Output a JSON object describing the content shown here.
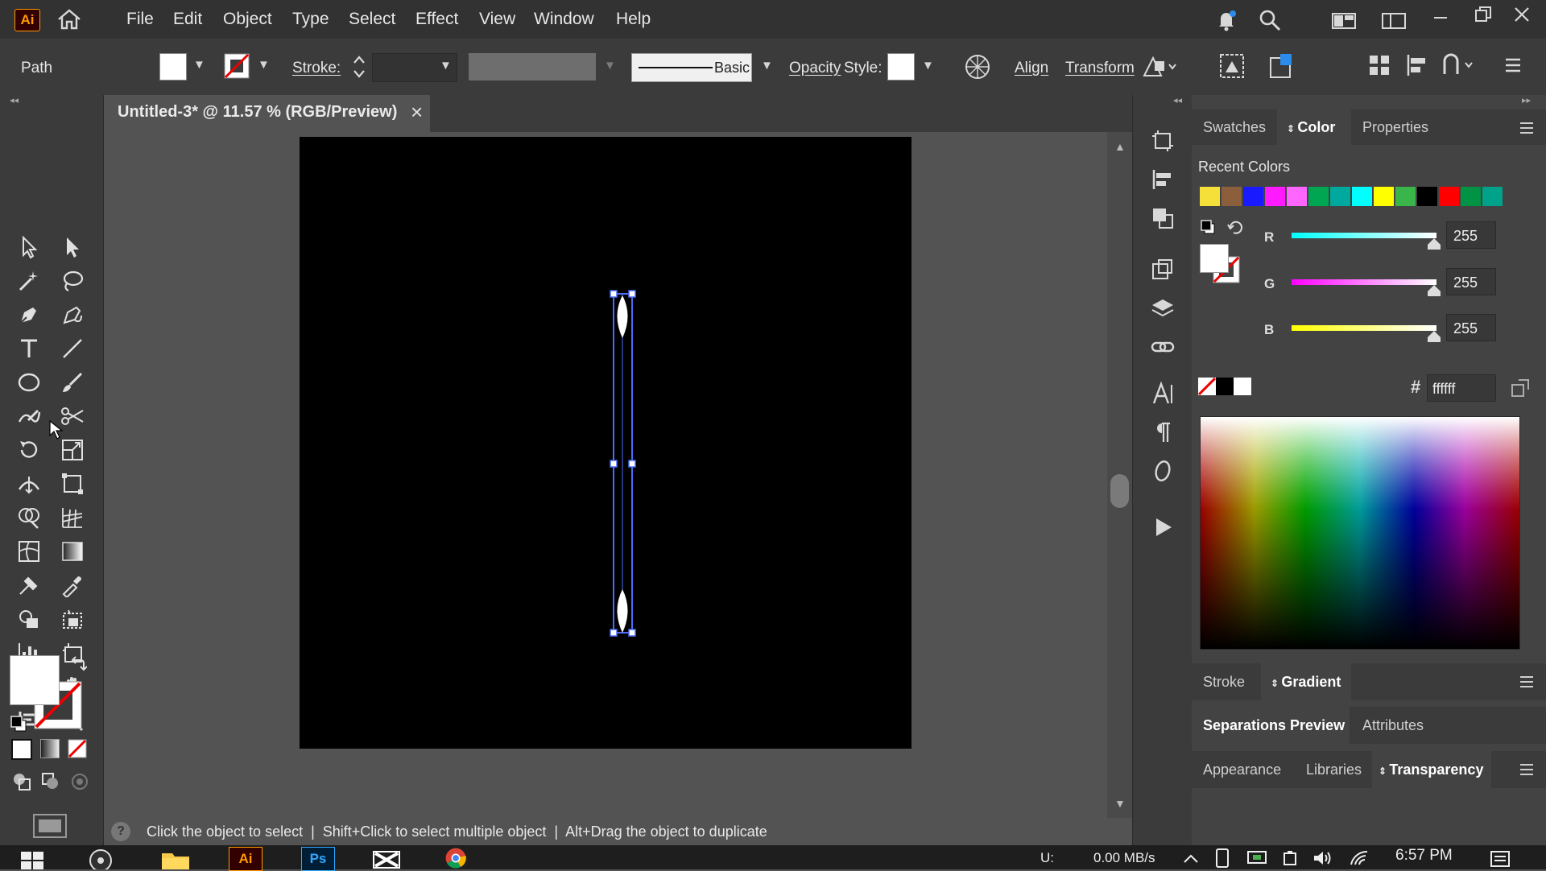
{
  "app": {
    "logo": "Ai"
  },
  "menu": [
    "File",
    "Edit",
    "Object",
    "Type",
    "Select",
    "Effect",
    "View",
    "Window",
    "Help"
  ],
  "control_bar": {
    "selection_type": "Path",
    "stroke_label": "Stroke:",
    "brush_label": "Basic",
    "opacity_label": "Opacity",
    "style_label": "Style:",
    "align_label": "Align",
    "transform_label": "Transform"
  },
  "document": {
    "tab_title": "Untitled-3* @ 11.57 % (RGB/Preview)",
    "close_glyph": "×"
  },
  "status": {
    "help_glyph": "?",
    "hint": "Click the object to select  |  Shift+Click to select multiple object  |  Alt+Drag the object to duplicate"
  },
  "color_panel": {
    "tabs": [
      "Swatches",
      "Color",
      "Properties"
    ],
    "active_tab": "Color",
    "recent_colors_label": "Recent Colors",
    "recent_colors": [
      "#f5e03a",
      "#8b5e3c",
      "#1a1aff",
      "#ff1aff",
      "#ff66ff",
      "#00a651",
      "#00a99d",
      "#00ffff",
      "#ffff00",
      "#39b54a",
      "#000000",
      "#ff0000",
      "#009245",
      "#00a38a"
    ],
    "channels": [
      {
        "label": "R",
        "value": "255",
        "gradient_from": "#00ffff",
        "gradient_to": "#ffffff"
      },
      {
        "label": "G",
        "value": "255",
        "gradient_from": "#ff00ff",
        "gradient_to": "#ffffff"
      },
      {
        "label": "B",
        "value": "255",
        "gradient_from": "#ffff00",
        "gradient_to": "#ffffff"
      }
    ],
    "hex_symbol": "#",
    "hex_value": "ffffff"
  },
  "stroke_gradient_panel": {
    "tabs": [
      "Stroke",
      "Gradient"
    ],
    "active_tab": "Gradient"
  },
  "separations_panel": {
    "tabs": [
      "Separations Preview",
      "Attributes"
    ],
    "active_tab": "Separations Preview"
  },
  "appearance_panel": {
    "tabs": [
      "Appearance",
      "Libraries",
      "Transparency"
    ],
    "active_tab": "Transparency"
  },
  "taskbar": {
    "net_label": "U:",
    "net_speed": "0.00 MB/s",
    "time": "6:57 PM",
    "apps": [
      "windows-start",
      "obs",
      "file-explorer",
      "illustrator",
      "photoshop",
      "capcut",
      "chrome"
    ]
  }
}
